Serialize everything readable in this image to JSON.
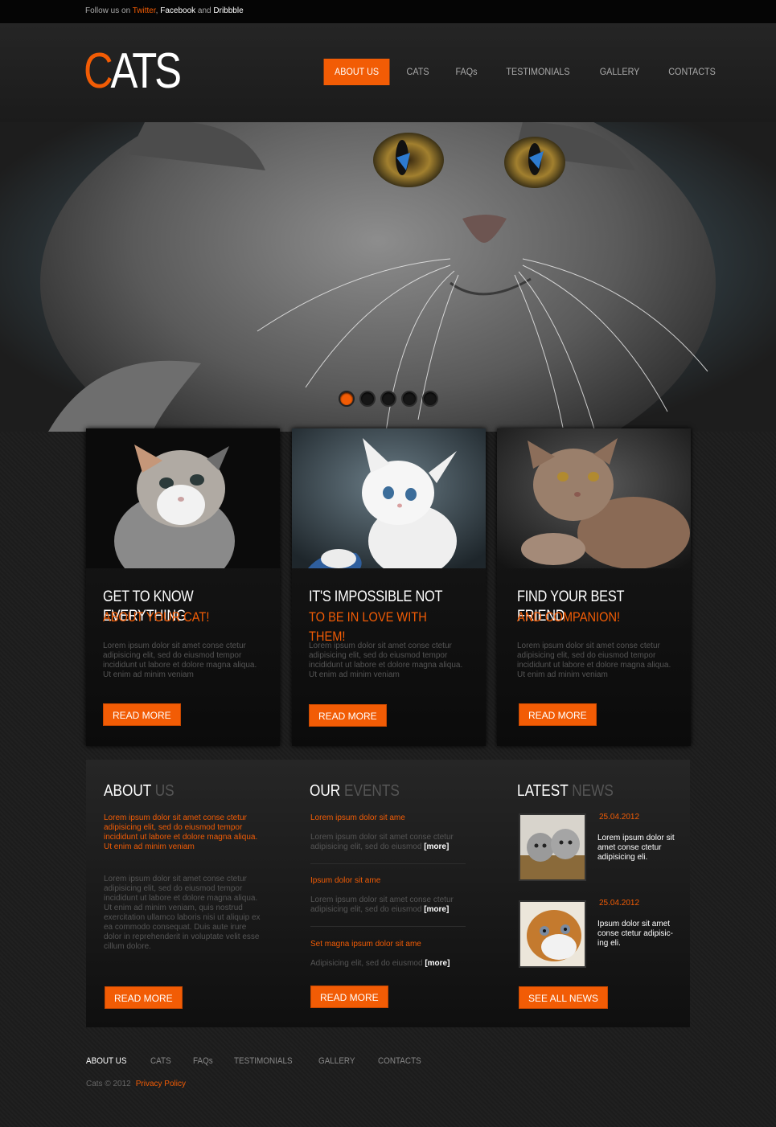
{
  "topbar": {
    "prefix": "Follow us on ",
    "twitter": "Twitter",
    "comma": ", ",
    "facebook": "Facebook",
    "and": " and ",
    "dribbble": "Dribbble"
  },
  "logo": {
    "first_letter": "C",
    "rest": "ATS"
  },
  "nav": {
    "items": [
      {
        "label": "About us"
      },
      {
        "label": "Cats"
      },
      {
        "label": "FAQs"
      },
      {
        "label": "Testimonials"
      },
      {
        "label": "Gallery"
      },
      {
        "label": "Contacts"
      }
    ]
  },
  "slider": {
    "slides": 5,
    "active_slide": 1
  },
  "cards": [
    {
      "title": "GET TO KNOW EVERYTHING",
      "subtitle": "ABOUT YOUR CAT!",
      "text": "Lorem ipsum dolor sit amet conse ctetur adipisicing elit, sed do eiusmod tempor incididunt ut labore et dolore magna aliqua. Ut enim ad minim veniam",
      "button": "Read more"
    },
    {
      "title": "IT'S IMPOSSIBLE NOT",
      "subtitle": "TO BE IN LOVE WITH THEM!",
      "text": "Lorem ipsum dolor sit amet conse ctetur adipisicing elit, sed do eiusmod tempor incididunt ut labore et dolore magna aliqua. Ut enim ad minim veniam",
      "button": "Read more"
    },
    {
      "title": "FIND YOUR BEST FRIEND",
      "subtitle": "AND COMPANION!",
      "text": "Lorem ipsum dolor sit amet conse ctetur adipisicing elit, sed do eiusmod tempor incididunt ut labore et dolore magna aliqua. Ut enim ad minim veniam",
      "button": "Read more"
    }
  ],
  "about": {
    "title_main": "ABOUT ",
    "title_dim": "US",
    "lead": "Lorem ipsum dolor sit amet conse ctetur adipisicing elit, sed do eiusmod tempor incididunt ut labore et dolore magna aliqua. Ut enim ad minim veniam",
    "body": "Lorem ipsum dolor sit amet conse ctetur adipisicing elit, sed do eiusmod tempor incididunt ut labore et dolore magna aliqua. Ut enim ad minim veniam, quis nostrud exercitation ullamco laboris nisi ut aliquip ex ea commodo consequat. Duis aute irure dolor in reprehenderit in voluptate velit esse cillum dolore.",
    "button": "Read more"
  },
  "events": {
    "title_main": "OUR ",
    "title_dim": "EVENTS",
    "items": [
      {
        "title": "Lorem ipsum dolor sit ame",
        "text": "Lorem ipsum dolor sit amet conse ctetur adipisicing elit, sed do eiusmod ",
        "more": "[more]"
      },
      {
        "title": "Ipsum dolor sit ame",
        "text": "Lorem ipsum dolor sit amet conse ctetur adipisicing elit, sed do eiusmod ",
        "more": "[more]"
      },
      {
        "title": "Set magna ipsum dolor sit ame",
        "text": "Adipisicing elit, sed do eiusmod ",
        "more": "[more]"
      }
    ],
    "button": "Read more"
  },
  "news": {
    "title_main": "LATEST ",
    "title_dim": "NEWS",
    "items": [
      {
        "date": "25.04.2012",
        "text": "Lorem ipsum dolor sit amet conse ctetur adipisicing eli."
      },
      {
        "date": "25.04.2012",
        "text": "Ipsum dolor sit amet conse ctetur adipisic-ing eli."
      }
    ],
    "button": "See all news"
  },
  "footer": {
    "items": [
      {
        "label": "About us"
      },
      {
        "label": "Cats"
      },
      {
        "label": "FAQs"
      },
      {
        "label": "Testimonials"
      },
      {
        "label": "Gallery"
      },
      {
        "label": "Contacts"
      }
    ],
    "copyright": "Cats © 2012",
    "privacy": "Privacy Policy"
  },
  "colors": {
    "accent": "#f25c05",
    "background": "#1d1d1d",
    "topbar": "#050505"
  }
}
